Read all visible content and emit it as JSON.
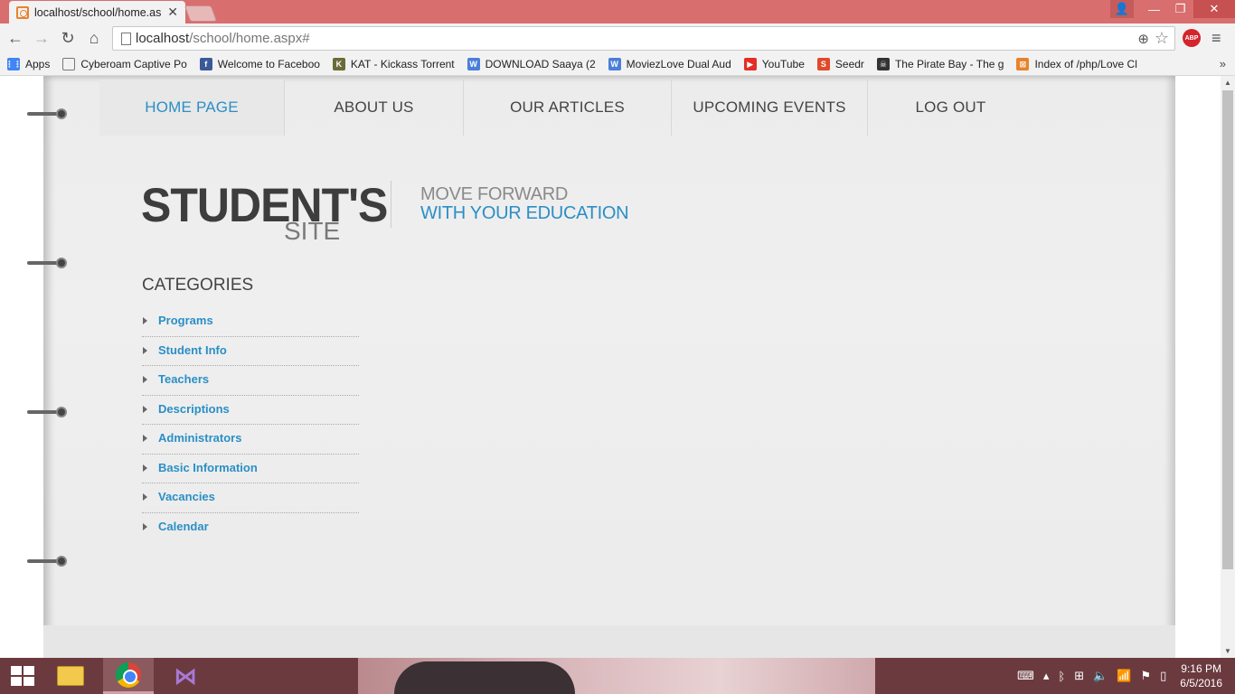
{
  "browser": {
    "tab_title": "localhost/school/home.as",
    "url_host": "localhost",
    "url_path": "/school/home.aspx#",
    "abp_label": "ABP",
    "bookmarks": [
      {
        "label": "Apps",
        "icon": "apps-grid-icon",
        "color": "#4285f4"
      },
      {
        "label": "Cyberoam Captive Po",
        "icon": "page-icon",
        "color": "#777777"
      },
      {
        "label": "Welcome to Faceboo",
        "icon": "facebook-icon",
        "color": "#3b5998"
      },
      {
        "label": "KAT - Kickass Torrent",
        "icon": "kat-icon",
        "color": "#6b6b3a"
      },
      {
        "label": "DOWNLOAD Saaya (2",
        "icon": "w-icon",
        "color": "#4a7fd8"
      },
      {
        "label": "MoviezLove Dual Aud",
        "icon": "w-icon",
        "color": "#4a7fd8"
      },
      {
        "label": "YouTube",
        "icon": "youtube-icon",
        "color": "#e52d27"
      },
      {
        "label": "Seedr",
        "icon": "seedr-icon",
        "color": "#e04a2a"
      },
      {
        "label": "The Pirate Bay - The g",
        "icon": "pirate-icon",
        "color": "#333333"
      },
      {
        "label": "Index of /php/Love Cl",
        "icon": "xampp-icon",
        "color": "#e8832b"
      }
    ],
    "bookmarks_more": "»"
  },
  "nav": {
    "items": [
      {
        "label": "HOME PAGE",
        "active": true
      },
      {
        "label": "ABOUT US",
        "active": false
      },
      {
        "label": "OUR ARTICLES",
        "active": false
      },
      {
        "label": "UPCOMING EVENTS",
        "active": false
      },
      {
        "label": "LOG OUT",
        "active": false
      }
    ]
  },
  "logo": {
    "main": "STUDENT'S",
    "sub": "SITE",
    "tagline_1": "MOVE FORWARD",
    "tagline_2": "WITH YOUR EDUCATION"
  },
  "categories": {
    "heading": "CATEGORIES",
    "items": [
      "Programs",
      "Student Info",
      "Teachers",
      "Descriptions",
      "Administrators",
      "Basic Information",
      "Vacancies",
      "Calendar"
    ]
  },
  "taskbar": {
    "time": "9:16 PM",
    "date": "6/5/2016"
  },
  "colors": {
    "accent": "#2a8fc6",
    "titlebar": "#d96e6e",
    "taskbar": "#6b3a3f"
  }
}
